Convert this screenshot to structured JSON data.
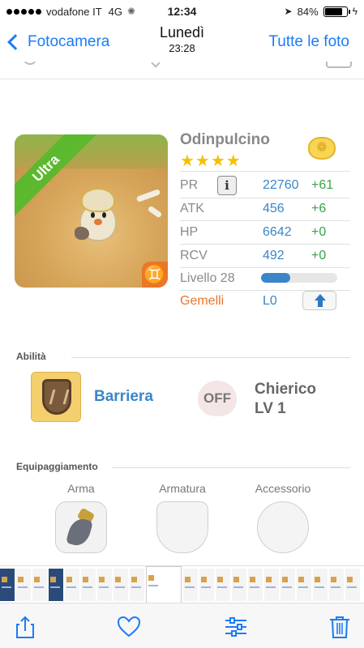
{
  "status_bar": {
    "carrier": "vodafone IT",
    "network": "4G",
    "time": "12:34",
    "battery": "84%",
    "battery_level": 0.84
  },
  "nav": {
    "back_label": "Fotocamera",
    "title": "Lunedì",
    "subtitle": "23:28",
    "right_label": "Tutte le foto"
  },
  "card": {
    "portrait": {
      "rank_ribbon": "Ultra",
      "zodiac_symbol": "♊"
    },
    "name": "Odinpulcino",
    "stars": "★★★★",
    "star_count": 4,
    "stats": [
      {
        "label": "PR",
        "value": "22760",
        "bonus": "+61"
      },
      {
        "label": "ATK",
        "value": "456",
        "bonus": "+6"
      },
      {
        "label": "HP",
        "value": "6642",
        "bonus": "+0"
      },
      {
        "label": "RCV",
        "value": "492",
        "bonus": "+0"
      }
    ],
    "info_button": "i",
    "level_label": "Livello 28",
    "level_progress": 0.38,
    "zodiac_label": "Gemelli",
    "zodiac_level": "L0"
  },
  "abilities": {
    "title": "Abilità",
    "skill1": "Barriera",
    "skill2_state": "OFF",
    "skill2_name": "Chierico",
    "skill2_level": "LV 1"
  },
  "equipment": {
    "title": "Equipaggiamento",
    "slots": [
      "Arma",
      "Armatura",
      "Accessorio"
    ]
  },
  "colors": {
    "accent_blue": "#1a7cf5",
    "stat_value": "#3a86c8",
    "stat_bonus": "#3aa345",
    "zodiac_orange": "#e8772a",
    "ultra_green": "#5cb82e"
  },
  "toolbar": {
    "icons": [
      "share-icon",
      "heart-icon",
      "adjust-icon",
      "trash-icon"
    ]
  }
}
